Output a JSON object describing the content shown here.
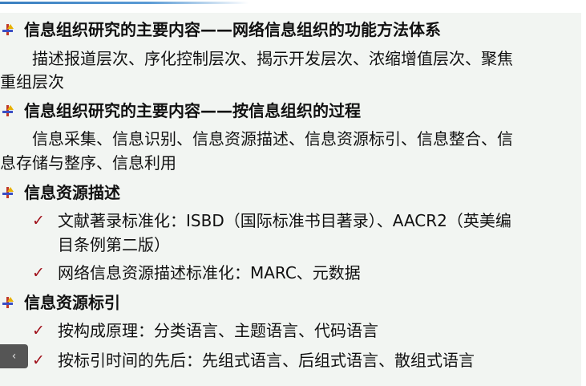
{
  "sections": [
    {
      "heading": "信息组织研究的主要内容——网络信息组织的功能方法体系",
      "body": [
        "描述报道层次、序化控制层次、揭示开发层次、浓缩增值层次、聚焦",
        "重组层次"
      ]
    },
    {
      "heading": "信息组织研究的主要内容——按信息组织的过程",
      "body": [
        "信息采集、信息识别、信息资源描述、信息资源标引、信息整合、信",
        "息存储与整序、信息利用"
      ]
    },
    {
      "heading": "信息资源描述",
      "items": [
        "文献著录标准化：ISBD（国际标准书目著录）、AACR2（英美编",
        "目条例第二版）",
        "网络信息资源描述标准化：MARC、元数据"
      ]
    },
    {
      "heading": "信息资源标引",
      "items": [
        "按构成原理：分类语言、主题语言、代码语言",
        "按标引时间的先后：先组式语言、后组式语言、散组式语言"
      ]
    }
  ],
  "check_glyph": "✓",
  "prev_glyph": "‹",
  "colors": {
    "check": "#a0101a",
    "accent_line": "#3a7fc0",
    "background": "#f2f5f2"
  }
}
